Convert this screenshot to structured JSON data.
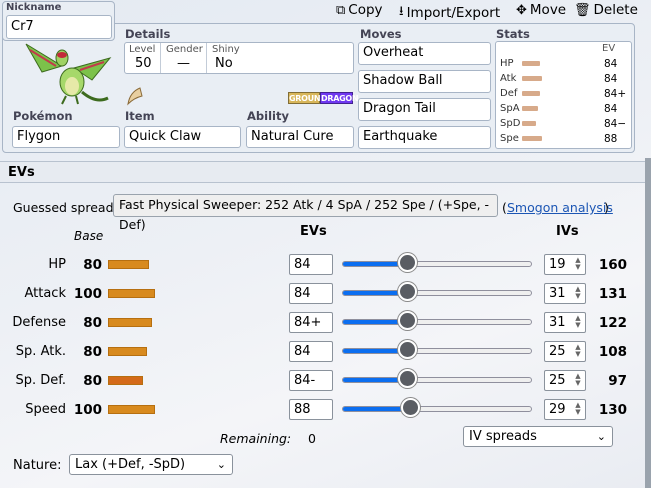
{
  "toolbar": {
    "copy_label": "Copy",
    "import_export_label": "Import/Export",
    "move_label": "Move",
    "delete_label": "Delete"
  },
  "nickname": {
    "label": "Nickname",
    "value": "Cr7"
  },
  "details": {
    "label": "Details",
    "level_label": "Level",
    "level": "50",
    "gender_label": "Gender",
    "gender": "—",
    "shiny_label": "Shiny",
    "shiny": "No"
  },
  "types": [
    "GROUND",
    "DRAGON"
  ],
  "type_colors": {
    "GROUND": "#d8b65a",
    "DRAGON": "#6f38f0"
  },
  "pokemon": {
    "label": "Pokémon",
    "value": "Flygon"
  },
  "item": {
    "label": "Item",
    "value": "Quick Claw"
  },
  "ability": {
    "label": "Ability",
    "value": "Natural Cure"
  },
  "moves": {
    "label": "Moves",
    "list": [
      "Overheat",
      "Shadow Ball",
      "Dragon Tail",
      "Earthquake"
    ]
  },
  "stats_panel": {
    "label": "Stats",
    "ev_header": "EV",
    "rows": [
      {
        "name": "HP",
        "value": "84"
      },
      {
        "name": "Atk",
        "value": "84"
      },
      {
        "name": "Def",
        "value": "84+"
      },
      {
        "name": "SpA",
        "value": "84"
      },
      {
        "name": "SpD",
        "value": "84−"
      },
      {
        "name": "Spe",
        "value": "88"
      }
    ]
  },
  "evs_section": {
    "title": "EVs",
    "guessed_label": "Guessed spread:",
    "guessed_value": "Fast Physical Sweeper: 252 Atk / 4 SpA / 252 Spe / (+Spe, -Def)",
    "paren_open": "(",
    "smogon_link": "Smogon analysis",
    "paren_close": ")",
    "base_header": "Base",
    "evs_header": "EVs",
    "ivs_header": "IVs",
    "rows": [
      {
        "name": "HP",
        "base": "80",
        "ev": "84",
        "iv": "19",
        "total": "160",
        "ev_fraction": 0.33
      },
      {
        "name": "Attack",
        "base": "100",
        "ev": "84",
        "iv": "31",
        "total": "131",
        "ev_fraction": 0.33
      },
      {
        "name": "Defense",
        "base": "80",
        "ev": "84+",
        "iv": "31",
        "total": "122",
        "ev_fraction": 0.33
      },
      {
        "name": "Sp. Atk.",
        "base": "80",
        "ev": "84",
        "iv": "25",
        "total": "108",
        "ev_fraction": 0.33
      },
      {
        "name": "Sp. Def.",
        "base": "80",
        "ev": "84-",
        "iv": "25",
        "total": "97",
        "ev_fraction": 0.33
      },
      {
        "name": "Speed",
        "base": "100",
        "ev": "88",
        "iv": "29",
        "total": "130",
        "ev_fraction": 0.35
      }
    ],
    "remaining_label": "Remaining:",
    "remaining_value": "0",
    "iv_spreads_select": "IV spreads",
    "nature_label": "Nature:",
    "nature_value": "Lax (+Def, -SpD)"
  },
  "colors": {
    "accent": "#0b6ef0",
    "base_bar": "#d88a1e",
    "link": "#1c56b4"
  }
}
